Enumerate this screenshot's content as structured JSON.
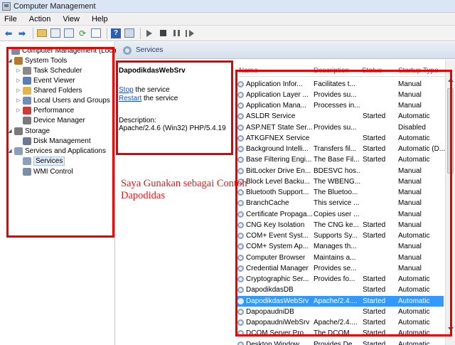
{
  "window": {
    "title": "Computer Management"
  },
  "menu": [
    "File",
    "Action",
    "View",
    "Help"
  ],
  "toolbar": {
    "icons": [
      "back-arrow-icon",
      "forward-arrow-icon",
      "up-folder-icon",
      "show-hide-tree-icon",
      "properties-icon",
      "refresh-icon",
      "export-icon",
      "help-icon",
      "console-icon",
      "start-service-icon",
      "stop-service-icon",
      "pause-service-icon",
      "restart-service-icon"
    ]
  },
  "tree": {
    "items": [
      {
        "label": "Computer Management (Local",
        "level": 0,
        "expander": "",
        "icon": "computer-icon",
        "color": "#7b8ca3"
      },
      {
        "label": "System Tools",
        "level": 1,
        "expander": "◢",
        "icon": "tools-icon",
        "color": "#b47b2c"
      },
      {
        "label": "Task Scheduler",
        "level": 2,
        "expander": "▷",
        "icon": "clock-icon",
        "color": "#8a8a8a"
      },
      {
        "label": "Event Viewer",
        "level": 2,
        "expander": "▷",
        "icon": "event-viewer-icon",
        "color": "#5a7fb0"
      },
      {
        "label": "Shared Folders",
        "level": 2,
        "expander": "▷",
        "icon": "shared-folder-icon",
        "color": "#e0b54e"
      },
      {
        "label": "Local Users and Groups",
        "level": 2,
        "expander": "▷",
        "icon": "users-icon",
        "color": "#6f8db5"
      },
      {
        "label": "Performance",
        "level": 2,
        "expander": "▷",
        "icon": "performance-icon",
        "color": "#c83c3c"
      },
      {
        "label": "Device Manager",
        "level": 2,
        "expander": "",
        "icon": "device-manager-icon",
        "color": "#7a7a7a"
      },
      {
        "label": "Storage",
        "level": 1,
        "expander": "◢",
        "icon": "storage-icon",
        "color": "#7a7a7a"
      },
      {
        "label": "Disk Management",
        "level": 2,
        "expander": "",
        "icon": "disk-icon",
        "color": "#6b7b8f"
      },
      {
        "label": "Services and Applications",
        "level": 1,
        "expander": "◢",
        "icon": "services-apps-icon",
        "color": "#8a9fb9"
      },
      {
        "label": "Services",
        "level": 2,
        "expander": "",
        "icon": "services-gear-icon",
        "color": "#8aa0bd",
        "selected": true
      },
      {
        "label": "WMI Control",
        "level": 2,
        "expander": "",
        "icon": "wmi-icon",
        "color": "#7a8ea8"
      }
    ]
  },
  "header": {
    "title": "Services"
  },
  "detail": {
    "name": "DapodikdasWebSrv",
    "stop_link": "Stop",
    "stop_rest": " the service",
    "restart_link": "Restart",
    "restart_rest": " the service",
    "description_label": "Description:",
    "description": "Apache/2.4.6 (Win32) PHP/5.4.19"
  },
  "columns": [
    "Name",
    "Description",
    "Status",
    "Startup Type"
  ],
  "services": [
    {
      "name": "Application Infor...",
      "desc": "Facilitates t...",
      "status": "",
      "startup": "Manual"
    },
    {
      "name": "Application Layer ...",
      "desc": "Provides su...",
      "status": "",
      "startup": "Manual"
    },
    {
      "name": "Application Mana...",
      "desc": "Processes in...",
      "status": "",
      "startup": "Manual"
    },
    {
      "name": "ASLDR Service",
      "desc": "",
      "status": "Started",
      "startup": "Automatic"
    },
    {
      "name": "ASP.NET State Ser...",
      "desc": "Provides su...",
      "status": "",
      "startup": "Disabled"
    },
    {
      "name": "ATKGFNEX Service",
      "desc": "",
      "status": "Started",
      "startup": "Automatic"
    },
    {
      "name": "Background Intelli...",
      "desc": "Transfers fil...",
      "status": "Started",
      "startup": "Automatic (D..."
    },
    {
      "name": "Base Filtering Engi...",
      "desc": "The Base Fil...",
      "status": "Started",
      "startup": "Automatic"
    },
    {
      "name": "BitLocker Drive En...",
      "desc": "BDESVC hos...",
      "status": "",
      "startup": "Manual"
    },
    {
      "name": "Block Level Backu...",
      "desc": "The WBENG...",
      "status": "",
      "startup": "Manual"
    },
    {
      "name": "Bluetooth Support...",
      "desc": "The Bluetoo...",
      "status": "",
      "startup": "Manual"
    },
    {
      "name": "BranchCache",
      "desc": "This service ...",
      "status": "",
      "startup": "Manual"
    },
    {
      "name": "Certificate Propaga...",
      "desc": "Copies user ...",
      "status": "",
      "startup": "Manual"
    },
    {
      "name": "CNG Key Isolation",
      "desc": "The CNG ke...",
      "status": "Started",
      "startup": "Manual"
    },
    {
      "name": "COM+ Event Syst...",
      "desc": "Supports Sy...",
      "status": "Started",
      "startup": "Automatic"
    },
    {
      "name": "COM+ System Ap...",
      "desc": "Manages th...",
      "status": "",
      "startup": "Manual"
    },
    {
      "name": "Computer Browser",
      "desc": "Maintains a...",
      "status": "",
      "startup": "Manual"
    },
    {
      "name": "Credential Manager",
      "desc": "Provides se...",
      "status": "",
      "startup": "Manual"
    },
    {
      "name": "Cryptographic Ser...",
      "desc": "Provides fo...",
      "status": "Started",
      "startup": "Automatic"
    },
    {
      "name": "DapodikdasDB",
      "desc": "",
      "status": "Started",
      "startup": "Automatic"
    },
    {
      "name": "DapodikdasWebSrv",
      "desc": "Apache/2.4....",
      "status": "Started",
      "startup": "Automatic",
      "selected": true
    },
    {
      "name": "DapopaudniDB",
      "desc": "",
      "status": "Started",
      "startup": "Automatic"
    },
    {
      "name": "DapopaudniWebSrv",
      "desc": "Apache/2.4....",
      "status": "Started",
      "startup": "Automatic"
    },
    {
      "name": "DCOM Server Pro...",
      "desc": "The DCOM ...",
      "status": "Started",
      "startup": "Automatic"
    },
    {
      "name": "Desktop Window ...",
      "desc": "Provides De...",
      "status": "Started",
      "startup": "Automatic"
    }
  ],
  "annotation": {
    "caption_line1": "Saya Gunakan sebagai Contoh",
    "caption_line2": "Dapodidas",
    "color": "#e80000"
  }
}
